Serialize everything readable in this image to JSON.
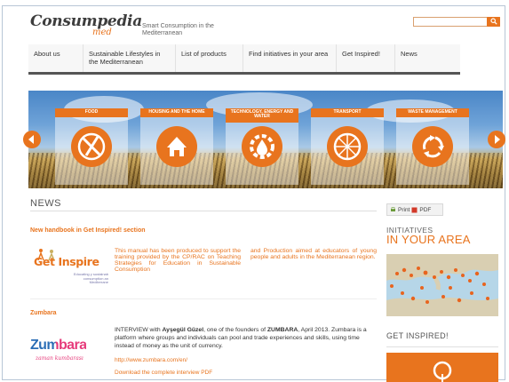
{
  "header": {
    "logo_main": "Consumpedia",
    "logo_sub": "med",
    "tagline": "Smart Consumption in the Mediterranean"
  },
  "nav": {
    "items": [
      {
        "label": "About us"
      },
      {
        "label": "Sustainable Lifestyles in the Mediterranean"
      },
      {
        "label": "List of products"
      },
      {
        "label": "Find initiatives in your area"
      },
      {
        "label": "Get Inspired!"
      },
      {
        "label": "News"
      }
    ]
  },
  "banner": {
    "categories": [
      {
        "label": "FOOD",
        "icon": "fork-knife-icon"
      },
      {
        "label": "HOUSING AND THE HOME",
        "icon": "house-icon"
      },
      {
        "label": "TECHNOLOGY, ENERGY AND WATER",
        "icon": "gear-drop-icon"
      },
      {
        "label": "TRANSPORT",
        "icon": "wheel-icon"
      },
      {
        "label": "WASTE MANAGEMENT",
        "icon": "recycle-icon"
      }
    ]
  },
  "news": {
    "title": "NEWS",
    "articles": [
      {
        "title": "New handbook in Get Inspired! section",
        "image_text": "Get Inspire",
        "image_subtext": "Educating y sustainab consumption an Mediterrane",
        "col1": "This manual has been produced to support the training provided by the CP/RAC on Teaching Strategies for Education in Sustainable Consumption",
        "col2": "and Production aimed at educators of young people and adults in the Mediterranean region."
      },
      {
        "title": "Zumbara",
        "image_text": "Zumbara",
        "image_subtext": "zaman kumbarası",
        "body_prefix": "INTERVIEW with ",
        "body_name": "Ayşegül Güzel",
        "body_mid": ", one of the founders of ",
        "body_org": "ZUMBARA",
        "body_suffix": ", April 2013. Zumbara is a platform where groups and individuals can pool and trade experiences and skills, using time instead of money as the unit of currency.",
        "link": "http://www.zumbara.com/en/",
        "download": "Download the complete interview PDF"
      }
    ]
  },
  "sidebar": {
    "print_label": "Print",
    "pdf_label": "PDF",
    "initiatives_line1": "INITIATIVES",
    "initiatives_line2": "IN YOUR AREA",
    "get_inspired": "GET INSPIRED!"
  },
  "colors": {
    "accent": "#e8741e",
    "zumbara_blue": "#2a6db5",
    "zumbara_pink": "#e63a7a"
  }
}
